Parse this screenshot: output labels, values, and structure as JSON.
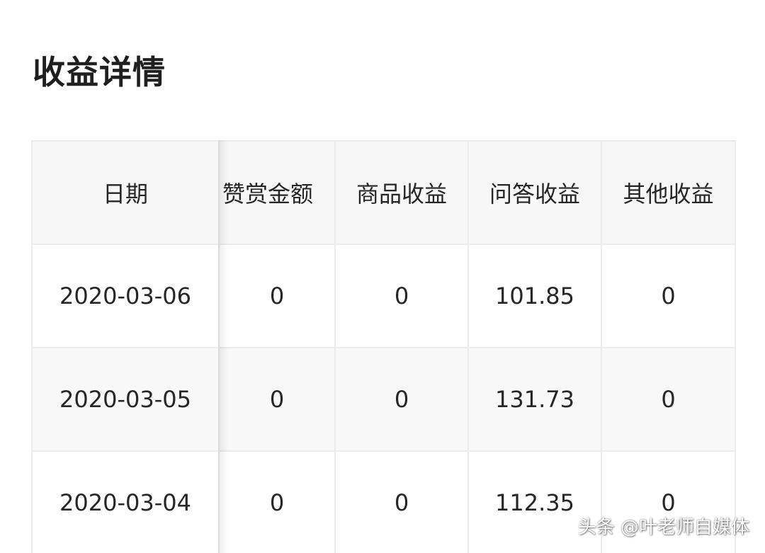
{
  "page": {
    "title": "收益详情"
  },
  "table": {
    "headers": [
      "日期",
      "赞赏金额",
      "商品收益",
      "问答收益",
      "其他收益"
    ],
    "rows": [
      [
        "2020-03-06",
        "0",
        "0",
        "101.85",
        "0"
      ],
      [
        "2020-03-05",
        "0",
        "0",
        "131.73",
        "0"
      ],
      [
        "2020-03-04",
        "0",
        "0",
        "112.35",
        "0"
      ]
    ]
  },
  "watermark": {
    "text": "头条 @叶老师自媒体"
  },
  "colors": {
    "header_bg": "#f7f7f7",
    "border": "#ececec",
    "text": "#262626"
  }
}
